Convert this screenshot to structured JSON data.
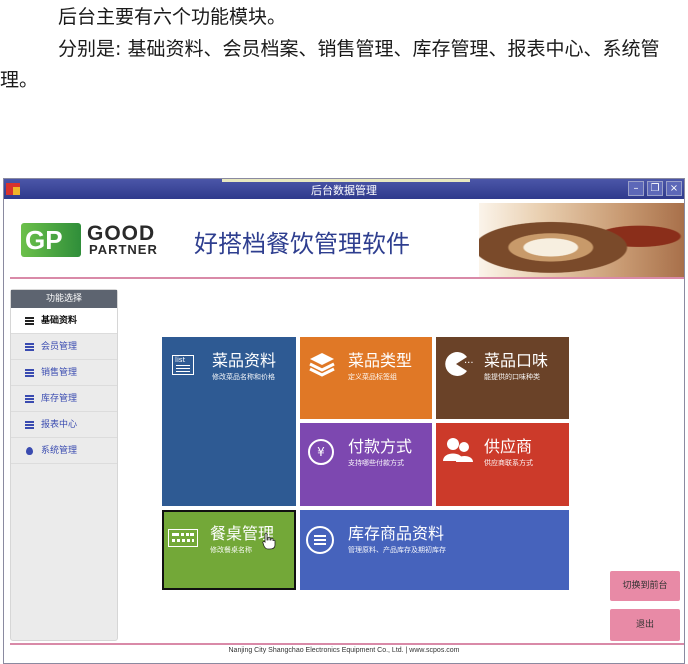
{
  "document": {
    "para1": "后台主要有六个功能模块。",
    "para2": "分别是: 基础资料、会员档案、销售管理、库存管理、报表中心、系统管理。"
  },
  "window": {
    "title": "后台数据管理",
    "minimize": "–",
    "restore": "❐",
    "close": "×"
  },
  "banner": {
    "logo_gp": "GP",
    "logo_good": "GOOD",
    "logo_partner": "PARTNER",
    "app_title": "好搭档餐饮管理软件"
  },
  "sidebar": {
    "header": "功能选择",
    "items": [
      {
        "label": "基础资料",
        "icon": "list-icon",
        "active": true
      },
      {
        "label": "会员管理",
        "icon": "list-icon",
        "active": false
      },
      {
        "label": "销售管理",
        "icon": "list-icon",
        "active": false
      },
      {
        "label": "库存管理",
        "icon": "list-icon",
        "active": false
      },
      {
        "label": "报表中心",
        "icon": "list-icon",
        "active": false
      },
      {
        "label": "系统管理",
        "icon": "drop-icon",
        "active": false
      }
    ]
  },
  "tiles": {
    "dishes": {
      "name": "菜品资料",
      "desc": "修改菜品名称和价格",
      "icon_label": "list",
      "color": "#2e5a93"
    },
    "dish_types": {
      "name": "菜品类型",
      "desc": "定义菜品标签组",
      "color": "#e07826"
    },
    "flavors": {
      "name": "菜品口味",
      "desc": "能提供的口味种类",
      "icon_dots": "...",
      "color": "#6a4228"
    },
    "payment": {
      "name": "付款方式",
      "desc": "支持哪些付款方式",
      "icon_symbol": "¥",
      "color": "#7d48b0"
    },
    "suppliers": {
      "name": "供应商",
      "desc": "供应商联系方式",
      "color": "#cc3a2a"
    },
    "tables": {
      "name": "餐桌管理",
      "desc": "修改餐桌名称",
      "color": "#73a838"
    },
    "inventory": {
      "name": "库存商品资料",
      "desc": "管理原料、产品库存及期初库存",
      "color": "#4663bc"
    }
  },
  "actions": {
    "switch_front": "切换到前台",
    "exit": "退出"
  },
  "footer": "Nanjing City Shangchao Electronics Equipment Co., Ltd.  |  www.scpos.com"
}
